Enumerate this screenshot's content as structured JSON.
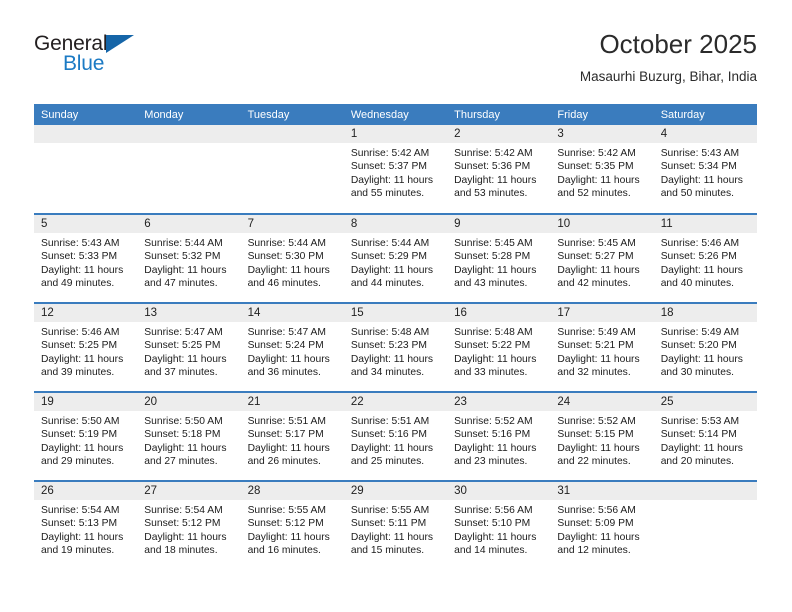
{
  "brand": {
    "name_part1": "General",
    "name_part2": "Blue",
    "accent_color": "#1b7ac4",
    "triangle_color": "#1565a8"
  },
  "header": {
    "title": "October 2025",
    "subtitle": "Masaurhi Buzurg, Bihar, India"
  },
  "theme": {
    "header_row_bg": "#3a7cbe",
    "daynum_bg": "#ededed",
    "divider": "#3a7cbe"
  },
  "calendar": {
    "weekday_headers": [
      "Sunday",
      "Monday",
      "Tuesday",
      "Wednesday",
      "Thursday",
      "Friday",
      "Saturday"
    ],
    "labels": {
      "sunrise": "Sunrise:",
      "sunset": "Sunset:",
      "daylight": "Daylight:"
    },
    "weeks": [
      [
        {
          "day": "",
          "sunrise": "",
          "sunset": "",
          "daylight_line1": "",
          "daylight_line2": ""
        },
        {
          "day": "",
          "sunrise": "",
          "sunset": "",
          "daylight_line1": "",
          "daylight_line2": ""
        },
        {
          "day": "",
          "sunrise": "",
          "sunset": "",
          "daylight_line1": "",
          "daylight_line2": ""
        },
        {
          "day": "1",
          "sunrise": "Sunrise: 5:42 AM",
          "sunset": "Sunset: 5:37 PM",
          "daylight_line1": "Daylight: 11 hours",
          "daylight_line2": "and 55 minutes."
        },
        {
          "day": "2",
          "sunrise": "Sunrise: 5:42 AM",
          "sunset": "Sunset: 5:36 PM",
          "daylight_line1": "Daylight: 11 hours",
          "daylight_line2": "and 53 minutes."
        },
        {
          "day": "3",
          "sunrise": "Sunrise: 5:42 AM",
          "sunset": "Sunset: 5:35 PM",
          "daylight_line1": "Daylight: 11 hours",
          "daylight_line2": "and 52 minutes."
        },
        {
          "day": "4",
          "sunrise": "Sunrise: 5:43 AM",
          "sunset": "Sunset: 5:34 PM",
          "daylight_line1": "Daylight: 11 hours",
          "daylight_line2": "and 50 minutes."
        }
      ],
      [
        {
          "day": "5",
          "sunrise": "Sunrise: 5:43 AM",
          "sunset": "Sunset: 5:33 PM",
          "daylight_line1": "Daylight: 11 hours",
          "daylight_line2": "and 49 minutes."
        },
        {
          "day": "6",
          "sunrise": "Sunrise: 5:44 AM",
          "sunset": "Sunset: 5:32 PM",
          "daylight_line1": "Daylight: 11 hours",
          "daylight_line2": "and 47 minutes."
        },
        {
          "day": "7",
          "sunrise": "Sunrise: 5:44 AM",
          "sunset": "Sunset: 5:30 PM",
          "daylight_line1": "Daylight: 11 hours",
          "daylight_line2": "and 46 minutes."
        },
        {
          "day": "8",
          "sunrise": "Sunrise: 5:44 AM",
          "sunset": "Sunset: 5:29 PM",
          "daylight_line1": "Daylight: 11 hours",
          "daylight_line2": "and 44 minutes."
        },
        {
          "day": "9",
          "sunrise": "Sunrise: 5:45 AM",
          "sunset": "Sunset: 5:28 PM",
          "daylight_line1": "Daylight: 11 hours",
          "daylight_line2": "and 43 minutes."
        },
        {
          "day": "10",
          "sunrise": "Sunrise: 5:45 AM",
          "sunset": "Sunset: 5:27 PM",
          "daylight_line1": "Daylight: 11 hours",
          "daylight_line2": "and 42 minutes."
        },
        {
          "day": "11",
          "sunrise": "Sunrise: 5:46 AM",
          "sunset": "Sunset: 5:26 PM",
          "daylight_line1": "Daylight: 11 hours",
          "daylight_line2": "and 40 minutes."
        }
      ],
      [
        {
          "day": "12",
          "sunrise": "Sunrise: 5:46 AM",
          "sunset": "Sunset: 5:25 PM",
          "daylight_line1": "Daylight: 11 hours",
          "daylight_line2": "and 39 minutes."
        },
        {
          "day": "13",
          "sunrise": "Sunrise: 5:47 AM",
          "sunset": "Sunset: 5:25 PM",
          "daylight_line1": "Daylight: 11 hours",
          "daylight_line2": "and 37 minutes."
        },
        {
          "day": "14",
          "sunrise": "Sunrise: 5:47 AM",
          "sunset": "Sunset: 5:24 PM",
          "daylight_line1": "Daylight: 11 hours",
          "daylight_line2": "and 36 minutes."
        },
        {
          "day": "15",
          "sunrise": "Sunrise: 5:48 AM",
          "sunset": "Sunset: 5:23 PM",
          "daylight_line1": "Daylight: 11 hours",
          "daylight_line2": "and 34 minutes."
        },
        {
          "day": "16",
          "sunrise": "Sunrise: 5:48 AM",
          "sunset": "Sunset: 5:22 PM",
          "daylight_line1": "Daylight: 11 hours",
          "daylight_line2": "and 33 minutes."
        },
        {
          "day": "17",
          "sunrise": "Sunrise: 5:49 AM",
          "sunset": "Sunset: 5:21 PM",
          "daylight_line1": "Daylight: 11 hours",
          "daylight_line2": "and 32 minutes."
        },
        {
          "day": "18",
          "sunrise": "Sunrise: 5:49 AM",
          "sunset": "Sunset: 5:20 PM",
          "daylight_line1": "Daylight: 11 hours",
          "daylight_line2": "and 30 minutes."
        }
      ],
      [
        {
          "day": "19",
          "sunrise": "Sunrise: 5:50 AM",
          "sunset": "Sunset: 5:19 PM",
          "daylight_line1": "Daylight: 11 hours",
          "daylight_line2": "and 29 minutes."
        },
        {
          "day": "20",
          "sunrise": "Sunrise: 5:50 AM",
          "sunset": "Sunset: 5:18 PM",
          "daylight_line1": "Daylight: 11 hours",
          "daylight_line2": "and 27 minutes."
        },
        {
          "day": "21",
          "sunrise": "Sunrise: 5:51 AM",
          "sunset": "Sunset: 5:17 PM",
          "daylight_line1": "Daylight: 11 hours",
          "daylight_line2": "and 26 minutes."
        },
        {
          "day": "22",
          "sunrise": "Sunrise: 5:51 AM",
          "sunset": "Sunset: 5:16 PM",
          "daylight_line1": "Daylight: 11 hours",
          "daylight_line2": "and 25 minutes."
        },
        {
          "day": "23",
          "sunrise": "Sunrise: 5:52 AM",
          "sunset": "Sunset: 5:16 PM",
          "daylight_line1": "Daylight: 11 hours",
          "daylight_line2": "and 23 minutes."
        },
        {
          "day": "24",
          "sunrise": "Sunrise: 5:52 AM",
          "sunset": "Sunset: 5:15 PM",
          "daylight_line1": "Daylight: 11 hours",
          "daylight_line2": "and 22 minutes."
        },
        {
          "day": "25",
          "sunrise": "Sunrise: 5:53 AM",
          "sunset": "Sunset: 5:14 PM",
          "daylight_line1": "Daylight: 11 hours",
          "daylight_line2": "and 20 minutes."
        }
      ],
      [
        {
          "day": "26",
          "sunrise": "Sunrise: 5:54 AM",
          "sunset": "Sunset: 5:13 PM",
          "daylight_line1": "Daylight: 11 hours",
          "daylight_line2": "and 19 minutes."
        },
        {
          "day": "27",
          "sunrise": "Sunrise: 5:54 AM",
          "sunset": "Sunset: 5:12 PM",
          "daylight_line1": "Daylight: 11 hours",
          "daylight_line2": "and 18 minutes."
        },
        {
          "day": "28",
          "sunrise": "Sunrise: 5:55 AM",
          "sunset": "Sunset: 5:12 PM",
          "daylight_line1": "Daylight: 11 hours",
          "daylight_line2": "and 16 minutes."
        },
        {
          "day": "29",
          "sunrise": "Sunrise: 5:55 AM",
          "sunset": "Sunset: 5:11 PM",
          "daylight_line1": "Daylight: 11 hours",
          "daylight_line2": "and 15 minutes."
        },
        {
          "day": "30",
          "sunrise": "Sunrise: 5:56 AM",
          "sunset": "Sunset: 5:10 PM",
          "daylight_line1": "Daylight: 11 hours",
          "daylight_line2": "and 14 minutes."
        },
        {
          "day": "31",
          "sunrise": "Sunrise: 5:56 AM",
          "sunset": "Sunset: 5:09 PM",
          "daylight_line1": "Daylight: 11 hours",
          "daylight_line2": "and 12 minutes."
        },
        {
          "day": "",
          "sunrise": "",
          "sunset": "",
          "daylight_line1": "",
          "daylight_line2": ""
        }
      ]
    ]
  }
}
